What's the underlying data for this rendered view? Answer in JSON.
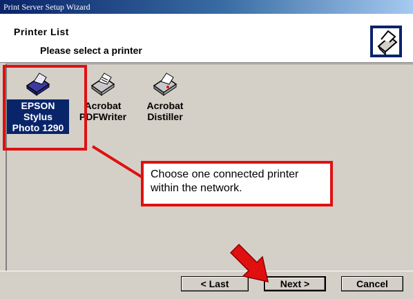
{
  "window": {
    "title": "Print Server Setup Wizard"
  },
  "header": {
    "title": "Printer  List",
    "subtitle": "Please select a printer",
    "icon": "printer-setup-icon"
  },
  "printers": [
    {
      "label": "EPSON\nStylus\nPhoto 1290",
      "selected": true,
      "icon": "epson-printer-icon"
    },
    {
      "label": "Acrobat\nPDFWriter",
      "selected": false,
      "icon": "acrobat-printer-icon"
    },
    {
      "label": "Acrobat\nDistiller",
      "selected": false,
      "icon": "acrobat-printer-icon"
    }
  ],
  "callout": {
    "text": "Choose one connected printer within the network."
  },
  "buttons": {
    "last": "< Last",
    "next": "Next >",
    "cancel": "Cancel"
  },
  "colors": {
    "annotation": "#e01010",
    "selection": "#0a246a",
    "titlebar": "#0a246a"
  }
}
